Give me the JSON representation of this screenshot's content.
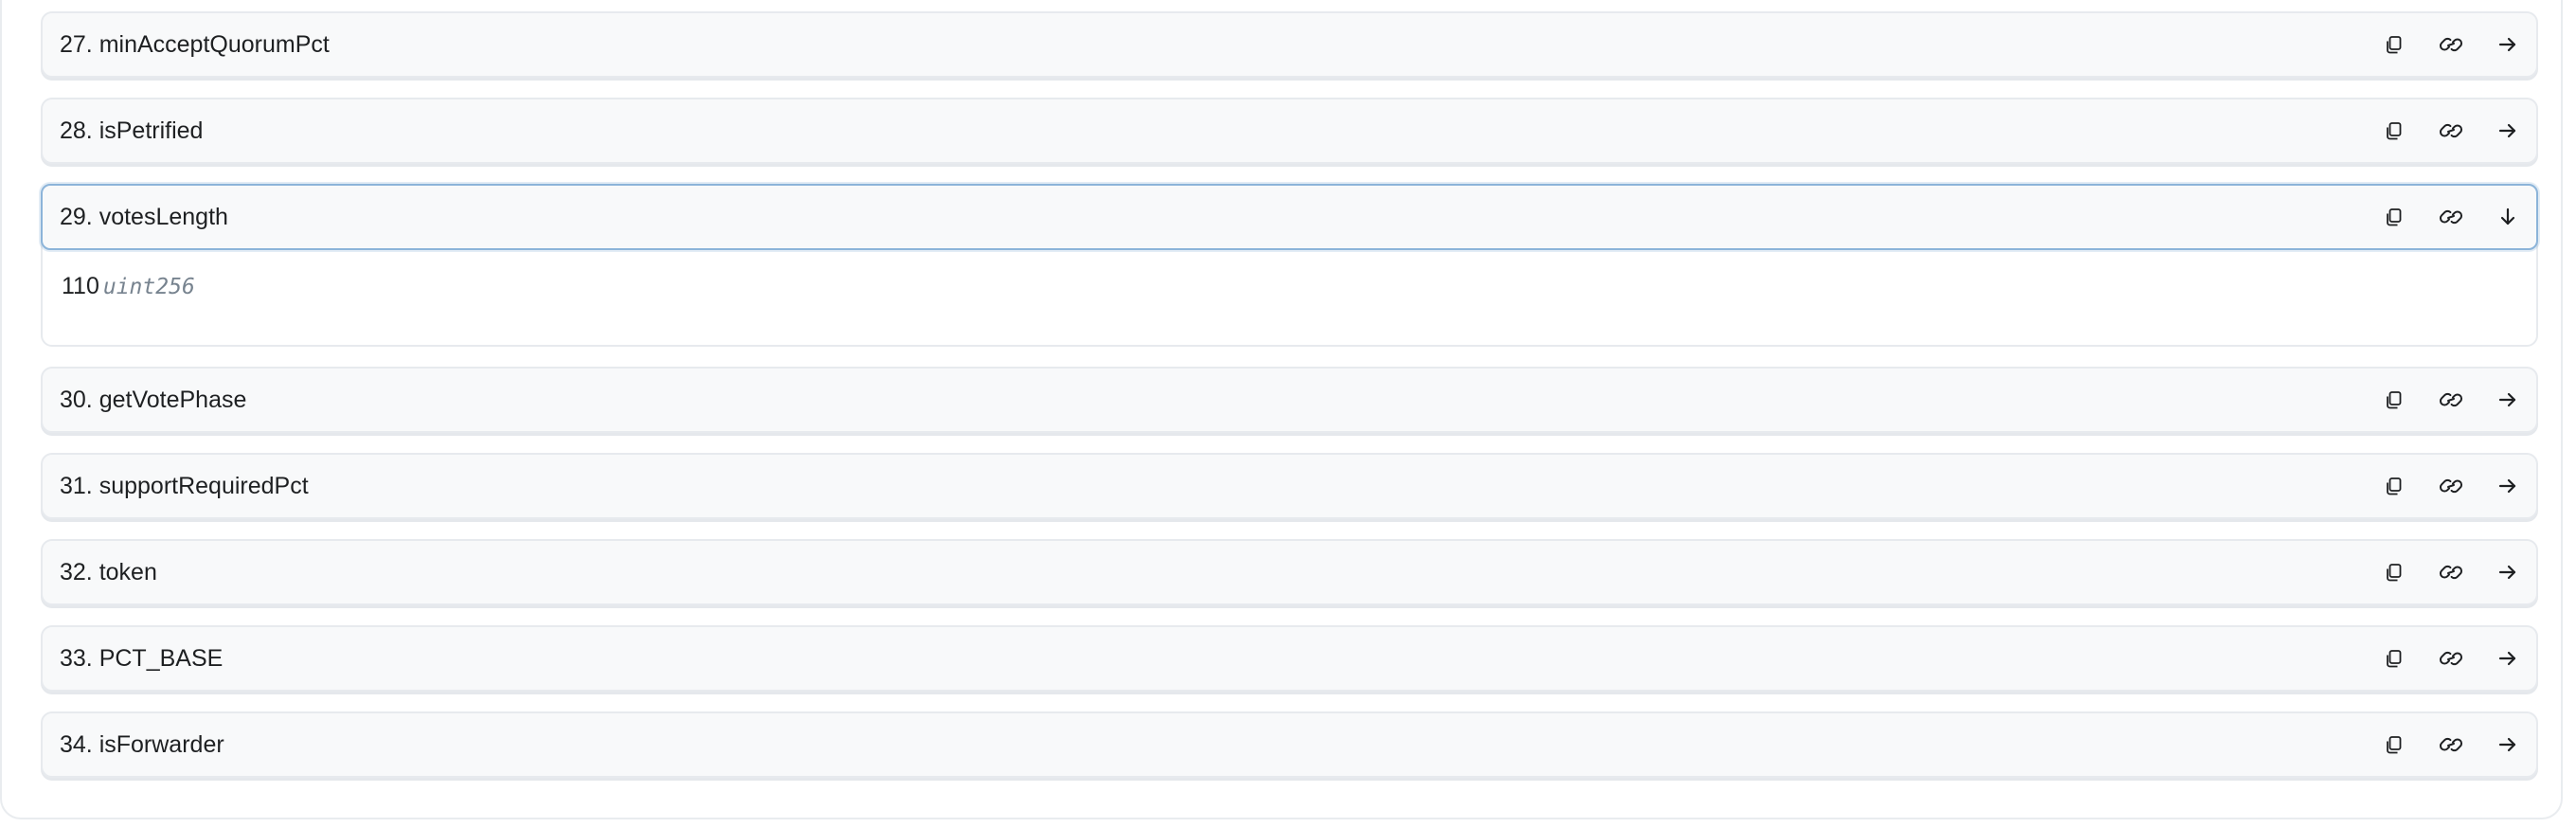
{
  "items": [
    {
      "title": "27. minAcceptQuorumPct",
      "expanded": false
    },
    {
      "title": "28. isPetrified",
      "expanded": false
    },
    {
      "title": "29. votesLength",
      "expanded": true,
      "result": {
        "value": "110",
        "type": "uint256"
      }
    },
    {
      "title": "30. getVotePhase",
      "expanded": false
    },
    {
      "title": "31. supportRequiredPct",
      "expanded": false
    },
    {
      "title": "32. token",
      "expanded": false
    },
    {
      "title": "33. PCT_BASE",
      "expanded": false
    },
    {
      "title": "34. isForwarder",
      "expanded": false
    }
  ],
  "icons": {
    "copy": "copy-icon",
    "link": "link-icon",
    "collapsed": "arrow-right-icon",
    "expanded": "arrow-down-icon"
  },
  "colors": {
    "item_bg": "#f8f9fa",
    "item_border": "#e7eaee",
    "focus_border": "#8cb4d9",
    "text": "#1e2022",
    "muted": "#77838f"
  }
}
